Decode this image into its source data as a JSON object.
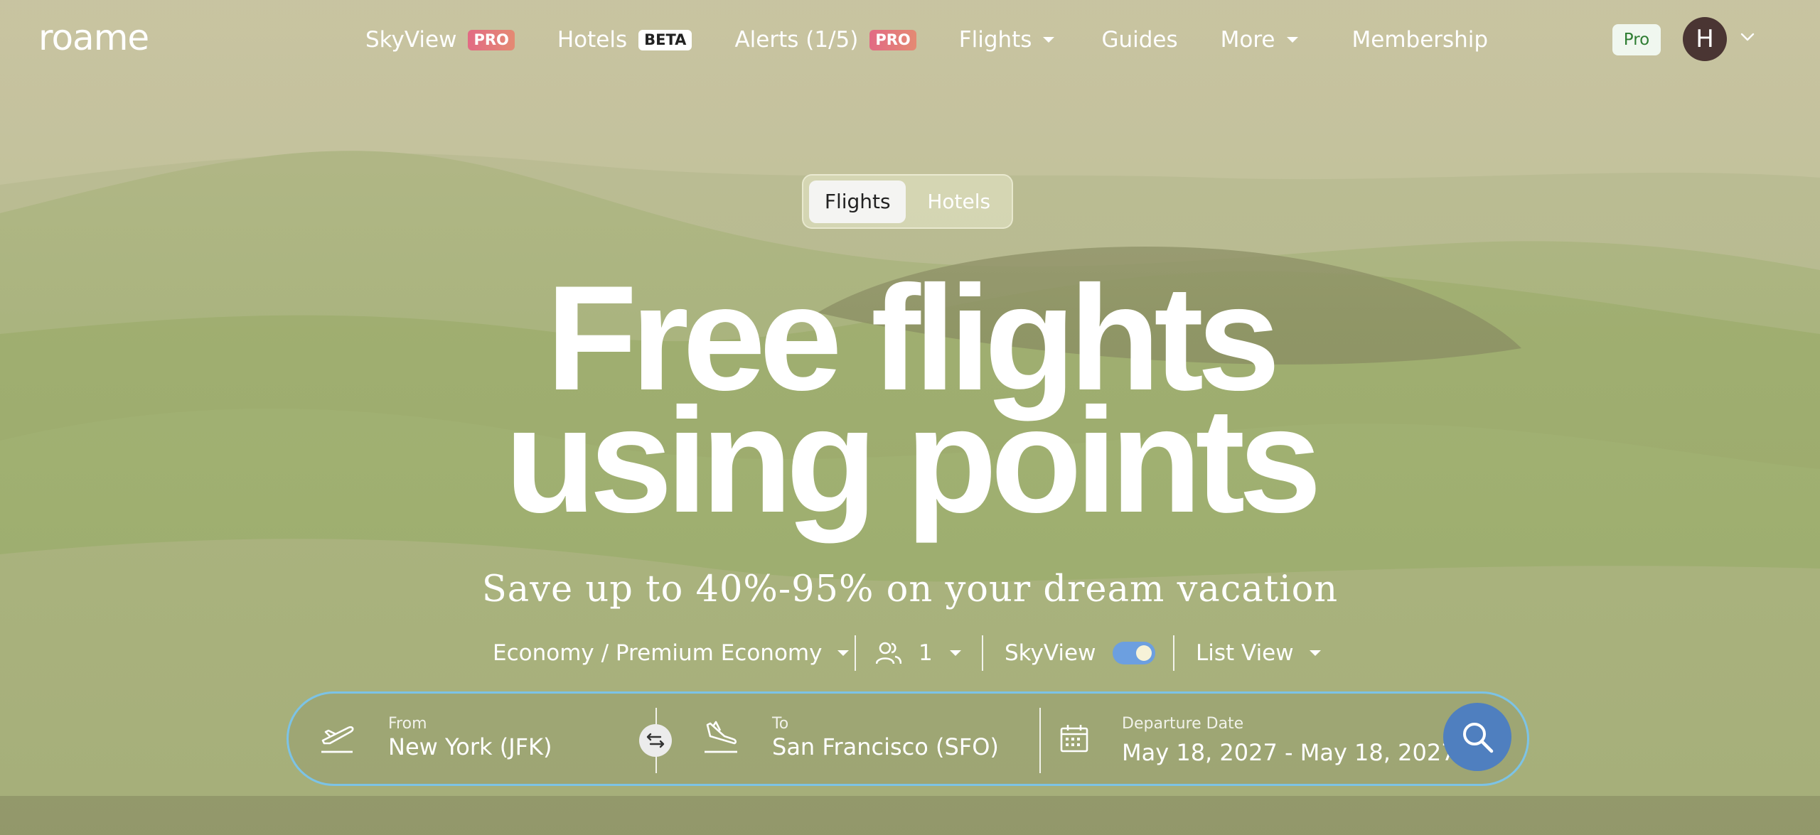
{
  "brand": {
    "logo": "roame"
  },
  "nav": {
    "items": [
      {
        "label": "SkyView",
        "badge": "PRO"
      },
      {
        "label": "Hotels",
        "badge": "BETA"
      },
      {
        "label": "Alerts (1/5)",
        "badge": "PRO"
      },
      {
        "label": "Flights"
      },
      {
        "label": "Guides"
      },
      {
        "label": "More"
      },
      {
        "label": "Membership"
      }
    ],
    "pro_pill": "Pro",
    "avatar_initial": "H"
  },
  "mode_toggle": {
    "flights": "Flights",
    "hotels": "Hotels",
    "selected": "Flights"
  },
  "hero": {
    "line1": "Free flights",
    "line2": "using points",
    "subtitle": "Save up to 40%-95% on your dream vacation"
  },
  "options": {
    "cabin": "Economy / Premium Economy",
    "passengers": "1",
    "skyview_label": "SkyView",
    "skyview_on": true,
    "view": "List View"
  },
  "search": {
    "from_label": "From",
    "from_value": "New York (JFK)",
    "to_label": "To",
    "to_value": "San Francisco (SFO)",
    "date_label": "Departure Date",
    "date_value": "May 18, 2027 - May 18, 2027"
  },
  "colors": {
    "pro_badge": "#e26a84",
    "search_button": "#4f7fbf",
    "search_border": "#7cc3e6",
    "toggle_on": "#6c9fe0",
    "avatar_bg": "#4a3533"
  }
}
